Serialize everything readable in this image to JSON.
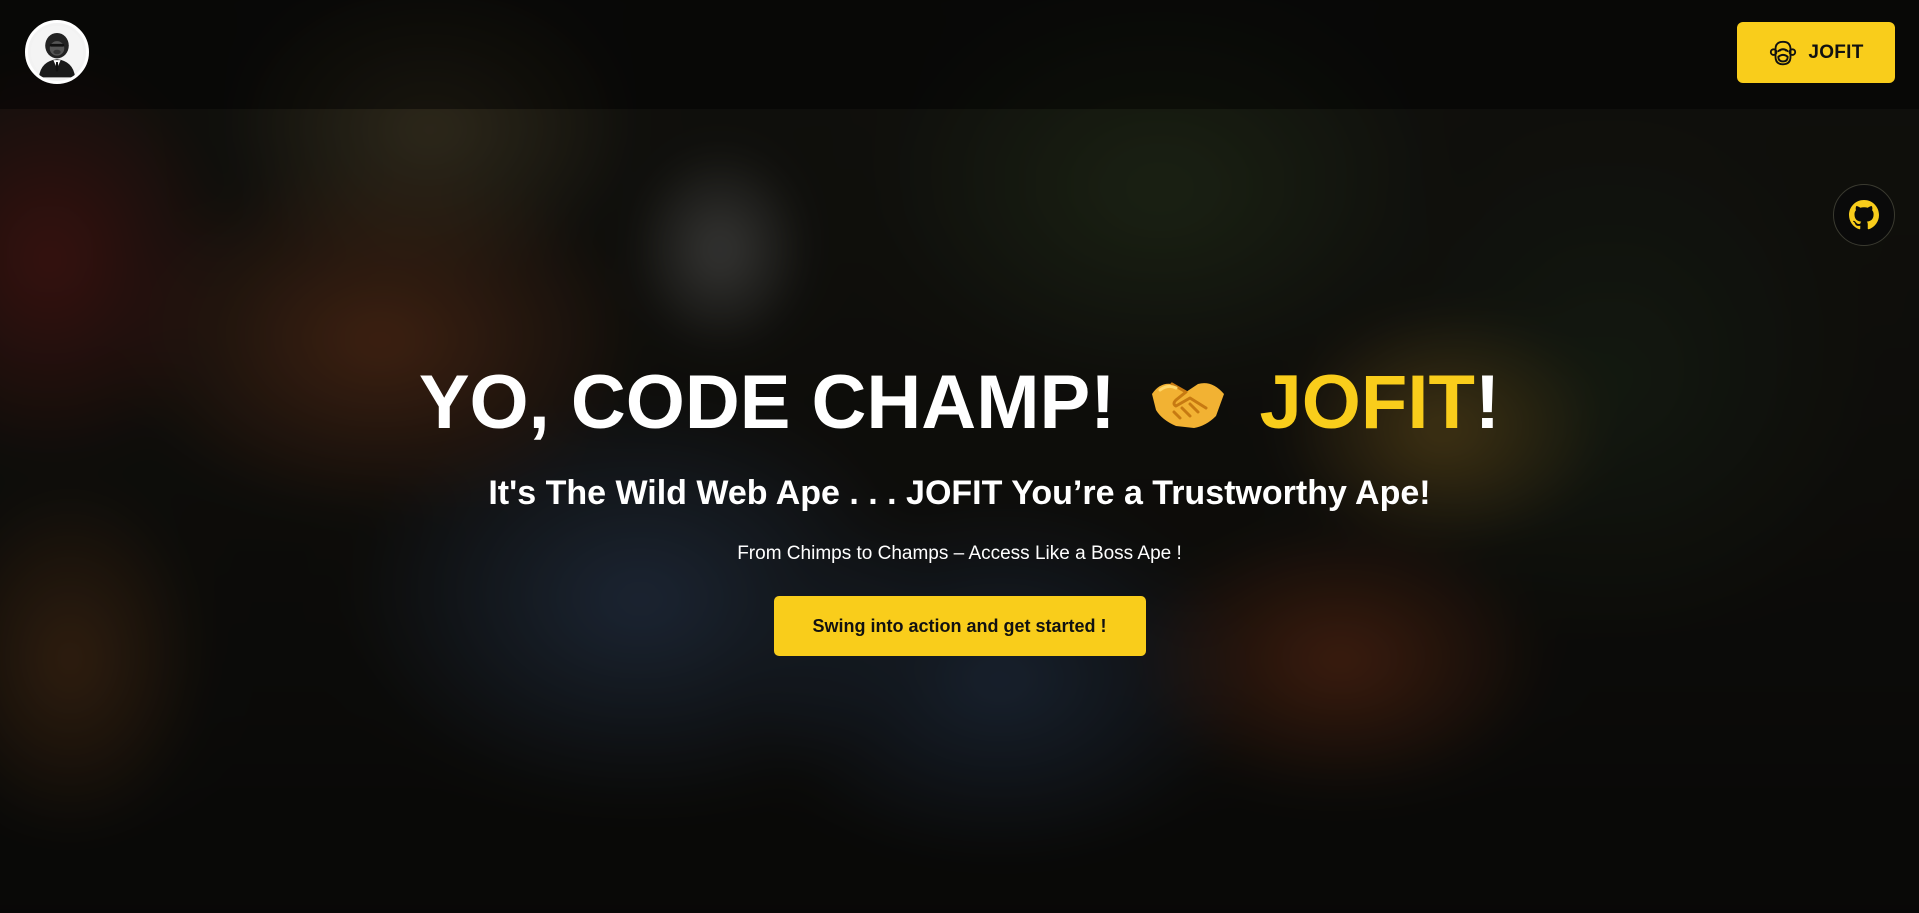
{
  "header": {
    "logo_icon": "gorilla-logo-icon",
    "cta_label": "JOFIT",
    "cta_icon": "ape-face-icon"
  },
  "floating": {
    "github_icon": "github-icon"
  },
  "hero": {
    "headline_main": "YO, CODE CHAMP!",
    "headline_icon": "handshake-icon",
    "headline_accent": "JOFIT",
    "headline_end": "!",
    "subhead": "It's The Wild Web Ape . . . JOFIT You’re a Trustworthy Ape!",
    "tagline": "From Chimps to Champs – Access Like a Boss Ape !",
    "cta_label": "Swing into action and get started !"
  },
  "colors": {
    "accent": "#f9cd1b",
    "text": "#ffffff",
    "button_text": "#111111"
  }
}
